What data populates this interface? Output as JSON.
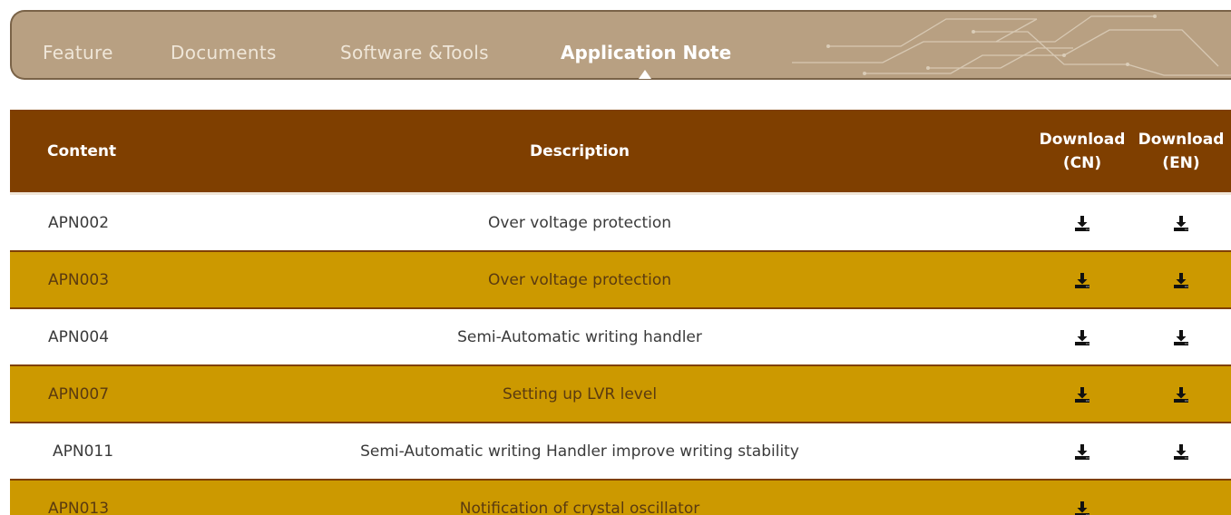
{
  "tabs": [
    {
      "label": "Feature",
      "active": false
    },
    {
      "label": "Documents",
      "active": false
    },
    {
      "label": "Software &Tools",
      "active": false
    },
    {
      "label": "Application Note",
      "active": true
    }
  ],
  "table": {
    "headers": {
      "content": "Content",
      "description": "Description",
      "download_cn_line1": "Download",
      "download_cn_line2": "(CN)",
      "download_en_line1": "Download",
      "download_en_line2": "(EN)"
    },
    "rows": [
      {
        "content": "APN002",
        "description": "Over voltage protection",
        "cn": "download-icon",
        "en": "download-icon"
      },
      {
        "content": "APN003",
        "description": "Over voltage protection",
        "cn": "download-icon",
        "en": "download-icon"
      },
      {
        "content": "APN004",
        "description": "Semi-Automatic writing handler",
        "cn": "download-icon",
        "en": "download-icon"
      },
      {
        "content": "APN007",
        "description": "Setting up LVR level",
        "cn": "download-icon",
        "en": "download-icon"
      },
      {
        "content": "APN011",
        "description": "Semi-Automatic writing Handler improve writing stability",
        "cn": "download-icon",
        "en": "download-icon"
      },
      {
        "content": "APN013",
        "description": "Notification of crystal oscillator",
        "cn": "download-icon",
        "en": ""
      }
    ]
  },
  "colors": {
    "tabbar_bg": "#b8a082",
    "header_bg": "#7f3f00",
    "alt_row_bg": "#cc9900"
  }
}
